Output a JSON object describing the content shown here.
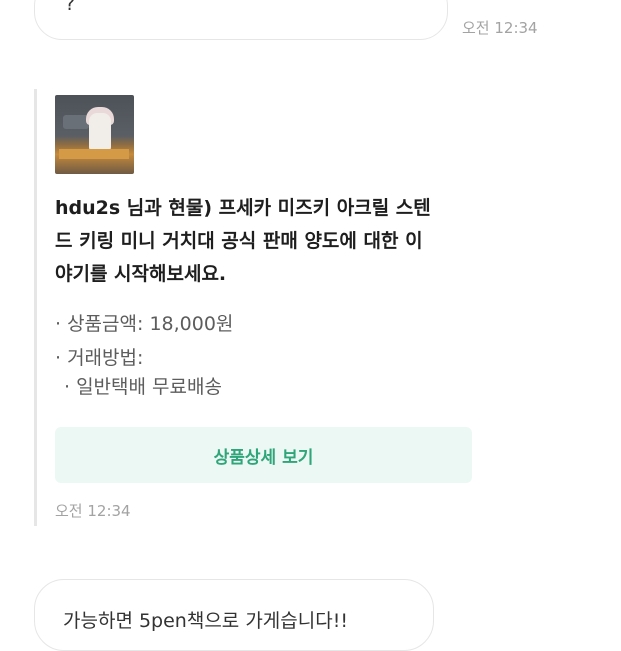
{
  "messages": {
    "top_bubble": {
      "text": "?",
      "time": "오전 12:34"
    },
    "product_card": {
      "title_lines": [
        "hdu2s 님과 현물) 프세카 미즈키 아크릴 스텐",
        "드 키링 미니 거치대 공식 판매 양도에 대한 이",
        "야기를 시작해보세요."
      ],
      "price": "· 상품금액: 18,000원",
      "method_label": "· 거래방법:",
      "method_value": "· 일반택배 무료배송",
      "button_label": "상품상세 보기",
      "time": "오전 12:34"
    },
    "bottom_bubble": {
      "text": "가능하면 5pen책으로 가게습니다!!"
    }
  },
  "colors": {
    "accent_text": "#2fa57a",
    "button_bg": "#ecf8f4",
    "border": "#e6e6e6",
    "timestamp": "#a3a3a3"
  }
}
